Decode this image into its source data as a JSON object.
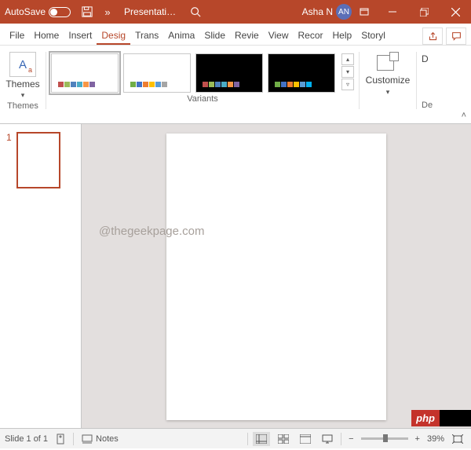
{
  "titlebar": {
    "autosave_label": "AutoSave",
    "doc_title": "Presentati…",
    "user_name": "Asha N",
    "user_initials": "AN"
  },
  "tabs": {
    "file": "File",
    "home": "Home",
    "insert": "Insert",
    "design": "Desig",
    "transitions": "Trans",
    "animations": "Anima",
    "slideshow": "Slide",
    "review": "Revie",
    "view": "View",
    "recording": "Recor",
    "help": "Help",
    "storyline": "Storyl"
  },
  "ribbon": {
    "themes_label": "Themes",
    "themes_group": "Themes",
    "variants_group": "Variants",
    "customize_label": "Customize",
    "designer_group": "De"
  },
  "variants": [
    {
      "bg": "#ffffff",
      "selected": true,
      "swatches": [
        "#c0504d",
        "#9bbb59",
        "#4f81bd",
        "#4bacc6",
        "#f79646",
        "#8064a2"
      ]
    },
    {
      "bg": "#ffffff",
      "selected": false,
      "swatches": [
        "#70ad47",
        "#4472c4",
        "#ed7d31",
        "#ffc000",
        "#5b9bd5",
        "#a5a5a5"
      ]
    },
    {
      "bg": "#000000",
      "selected": false,
      "swatches": [
        "#c0504d",
        "#9bbb59",
        "#4f81bd",
        "#4bacc6",
        "#f79646",
        "#8064a2"
      ]
    },
    {
      "bg": "#000000",
      "selected": false,
      "swatches": [
        "#70ad47",
        "#4472c4",
        "#ed7d31",
        "#ffc000",
        "#5b9bd5",
        "#00b0f0"
      ]
    }
  ],
  "thumbnails": [
    {
      "num": "1"
    }
  ],
  "watermark": "@thegeekpage.com",
  "php_badge": "php",
  "status": {
    "slide_of": "Slide 1 of 1",
    "notes_label": "Notes",
    "zoom_value": "39%"
  }
}
